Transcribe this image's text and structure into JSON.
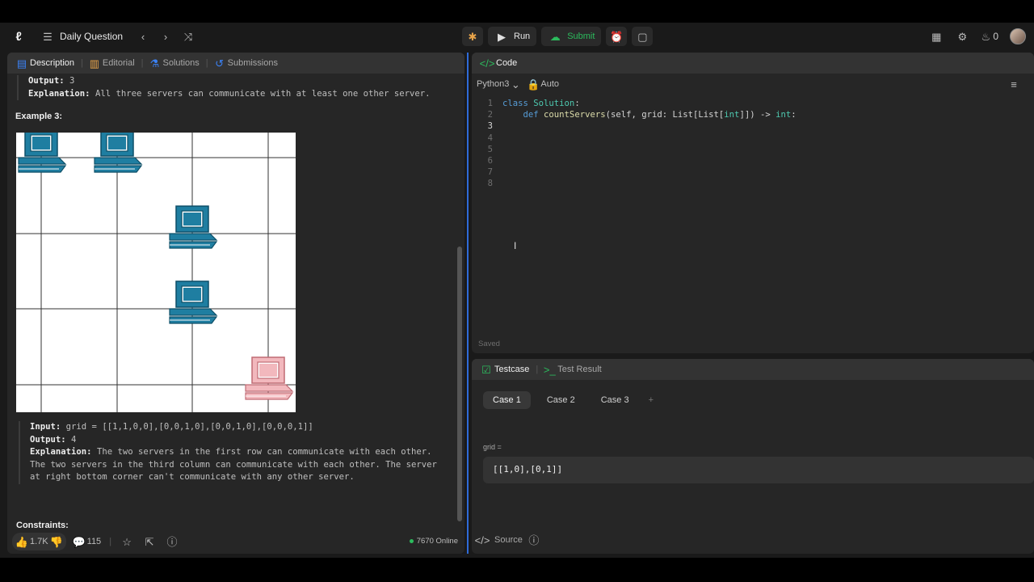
{
  "topbar": {
    "daily_question": "Daily Question",
    "run_label": "Run",
    "submit_label": "Submit",
    "streak_count": "0"
  },
  "left_tabs": [
    "Description",
    "Editorial",
    "Solutions",
    "Submissions"
  ],
  "description": {
    "ex2_output_label": "Output:",
    "ex2_output_value": "3",
    "ex2_expl_label": "Explanation:",
    "ex2_expl_text": "All three servers can communicate with at least one other server.",
    "ex3_title": "Example 3:",
    "ex3_input_label": "Input:",
    "ex3_input_value": "grid = [[1,1,0,0],[0,0,1,0],[0,0,1,0],[0,0,0,1]]",
    "ex3_output_label": "Output:",
    "ex3_output_value": "4",
    "ex3_expl_label": "Explanation:",
    "ex3_expl_text": "The two servers in the first row can communicate with each other. The two servers in the third column can communicate with each other. The server at right bottom corner can't communicate with any other server.",
    "constraints_title": "Constraints:"
  },
  "ex3_grid": [
    [
      1,
      1,
      0,
      0
    ],
    [
      0,
      0,
      1,
      0
    ],
    [
      0,
      0,
      1,
      0
    ],
    [
      0,
      0,
      0,
      1
    ]
  ],
  "ex3_isolated": [
    [
      3,
      3
    ]
  ],
  "colors": {
    "connected_server": "#1f7ea1",
    "isolated_server": "#f2b8bd",
    "accent_blue": "#2f6bd8",
    "submit_green": "#2cbb5d"
  },
  "bottombar": {
    "likes": "1.7K",
    "comments": "115",
    "online": "7670 Online"
  },
  "code": {
    "header": "Code",
    "language": "Python3",
    "mode": "Auto",
    "lines": [
      "class Solution:",
      "    def countServers(self, grid: List[List[int]]) -> int:",
      "",
      "",
      "",
      "",
      "",
      ""
    ],
    "saved": "Saved"
  },
  "testcase": {
    "tab_testcase": "Testcase",
    "tab_result": "Test Result",
    "cases": [
      "Case 1",
      "Case 2",
      "Case 3"
    ],
    "add": "+",
    "param_label": "grid =",
    "param_value": "[[1,0],[0,1]]",
    "source": "Source"
  }
}
